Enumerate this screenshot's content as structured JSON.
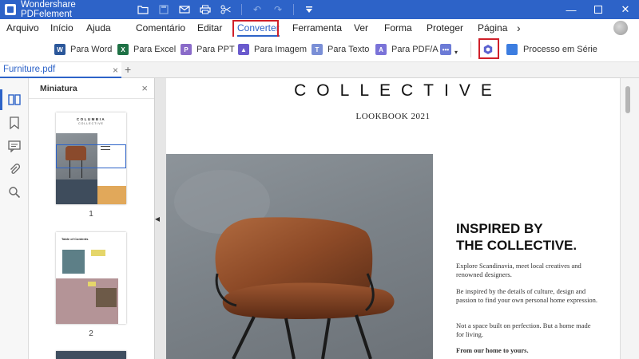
{
  "titlebar": {
    "app_title": "Wondershare PDFelement",
    "quick_icons": [
      "folder-icon",
      "save-icon",
      "mail-icon",
      "print-icon",
      "scissors-icon",
      "undo-icon",
      "redo-icon",
      "quick-access-dropdown-icon"
    ],
    "window_controls": [
      "minimize-icon",
      "maximize-icon",
      "close-icon"
    ]
  },
  "menu": {
    "items": [
      "Arquivo",
      "Início",
      "Ajuda",
      "Comentário",
      "Editar",
      "Converter",
      "Ferramenta",
      "Ver",
      "Forma",
      "Proteger",
      "Página"
    ],
    "active": "Converter",
    "more": "›"
  },
  "ribbon": {
    "buttons": [
      "Para Word",
      "Para Excel",
      "Para PPT",
      "Para Imagem",
      "Para Texto",
      "Para PDF/A",
      "Processo em Série"
    ],
    "colors": {
      "word": "#2b579a",
      "excel": "#1e7145",
      "ppt": "#8a6bc9",
      "image": "#6a5acd",
      "text": "#7a8fd6",
      "pdfa": "#7a73d8",
      "more": "#6c7bd6",
      "settings": "#5a62d0",
      "batch": "#3c7de0"
    }
  },
  "tab": {
    "label": "Furniture.pdf",
    "close": "×",
    "add": "+"
  },
  "panel": {
    "title": "Miniatura",
    "close": "×",
    "page_numbers": [
      "1",
      "2"
    ],
    "thumb1": {
      "brand": "COLUMBIA",
      "sub": "COLLECTIVE"
    },
    "thumb2": {
      "heading": "Table of Contents"
    }
  },
  "document": {
    "title": "COLLECTIVE",
    "subtitle": "LOOKBOOK 2021",
    "headline_1": "INSPIRED BY",
    "headline_2": "THE COLLECTIVE.",
    "paragraph_1": "Explore Scandinavia, meet local creatives and renowned designers.",
    "paragraph_2": "Be inspired by the details of culture, design and passion to find your own personal home expression.",
    "paragraph_3": "Not a space built on perfection. But a home made for living.",
    "paragraph_4": "From our home to yours."
  },
  "colors": {
    "accent": "#2d63c8",
    "highlight": "#d0202a"
  }
}
